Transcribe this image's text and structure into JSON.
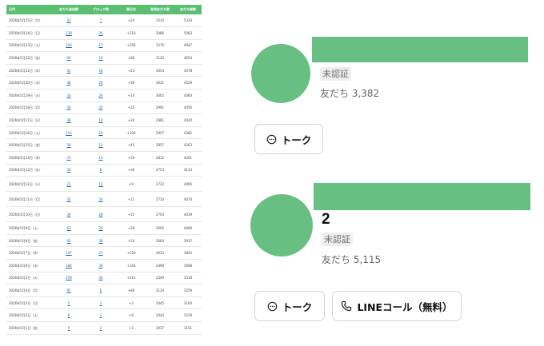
{
  "table": {
    "headers": [
      "日付",
      "友だち追加数",
      "ブロック数",
      "差分比",
      "有効友だち数",
      "友だち総数"
    ],
    "rows": [
      [
        "2026年5月25日（月）",
        "41",
        "7",
        "+24",
        "3510",
        "5334"
      ],
      [
        "2026年5月24日（日）",
        "138",
        "26",
        "+110",
        "3486",
        "5083"
      ],
      [
        "2026年5月23日（土）",
        "293",
        "17",
        "+256",
        "3376",
        "4947"
      ],
      [
        "2026年5月22日（金）",
        "94",
        "16",
        "+88",
        "3120",
        "4654"
      ],
      [
        "2026年5月21日（木）",
        "41",
        "18",
        "+23",
        "3054",
        "4578"
      ],
      [
        "2026年5月20日（水）",
        "46",
        "20",
        "+36",
        "3031",
        "4529"
      ],
      [
        "2026年5月19日（火）",
        "33",
        "29",
        "+14",
        "3005",
        "4483"
      ],
      [
        "2026年5月18日（月）",
        "30",
        "20",
        "+10",
        "2991",
        "4456"
      ],
      [
        "2026年5月17日（日）",
        "38",
        "14",
        "+24",
        "2981",
        "4420"
      ],
      [
        "2026年5月16日（土）",
        "114",
        "19",
        "+100",
        "2957",
        "4382"
      ],
      [
        "2026年5月15日（金）",
        "58",
        "13",
        "+45",
        "2857",
        "4263"
      ],
      [
        "2026年5月14日（木）",
        "72",
        "13",
        "+59",
        "2812",
        "4201"
      ],
      [
        "2026年5月13日（水）",
        "36",
        "8",
        "+30",
        "2753",
        "4133"
      ],
      [
        "2026年5月12日（火）",
        "21",
        "12",
        "+9",
        "2723",
        "4095"
      ],
      [
        "2026年5月11日（月）",
        "35",
        "24",
        "+11",
        "2714",
        "4074"
      ],
      [
        "2026年5月10日（日）",
        "39",
        "28",
        "+11",
        "2703",
        "4039"
      ],
      [
        "2026年5月9日（土）",
        "63",
        "35",
        "+28",
        "2692",
        "4000"
      ],
      [
        "2026年5月8日（金）",
        "92",
        "38",
        "+54",
        "2664",
        "3937"
      ],
      [
        "2026年5月7日（木）",
        "147",
        "27",
        "+120",
        "2610",
        "3845"
      ],
      [
        "2026年5月6日（水）",
        "184",
        "39",
        "+143",
        "2490",
        "3698"
      ],
      [
        "2026年5月5日（火）",
        "259",
        "44",
        "+215",
        "2349",
        "3518"
      ],
      [
        "2026年5月4日（月）",
        "95",
        "6",
        "+89",
        "2134",
        "3259"
      ],
      [
        "2026年5月3日（日）",
        "5",
        "3",
        "+2",
        "2045",
        "3164"
      ],
      [
        "2026年5月2日（土）",
        "8",
        "2",
        "+6",
        "2043",
        "3159"
      ],
      [
        "2026年5月1日（金）",
        "5",
        "2",
        "+3",
        "2037",
        "3151"
      ]
    ],
    "tall_rows": [
      13,
      14,
      15
    ]
  },
  "profiles": [
    {
      "name": "",
      "badge": "未認証",
      "friends": "友だち 3,382",
      "buttons": [
        {
          "label": "トーク",
          "icon": "chat-bubble-icon"
        }
      ]
    },
    {
      "name": "2",
      "badge": "未認証",
      "friends": "友だち 5,115",
      "buttons": [
        {
          "label": "トーク",
          "icon": "chat-bubble-icon"
        },
        {
          "label": "LINEコール（無料）",
          "icon": "phone-icon"
        }
      ]
    }
  ],
  "colors": {
    "header_green": "#5bbf72",
    "avatar_green": "#68bf82",
    "link_blue": "#2a5db0"
  }
}
